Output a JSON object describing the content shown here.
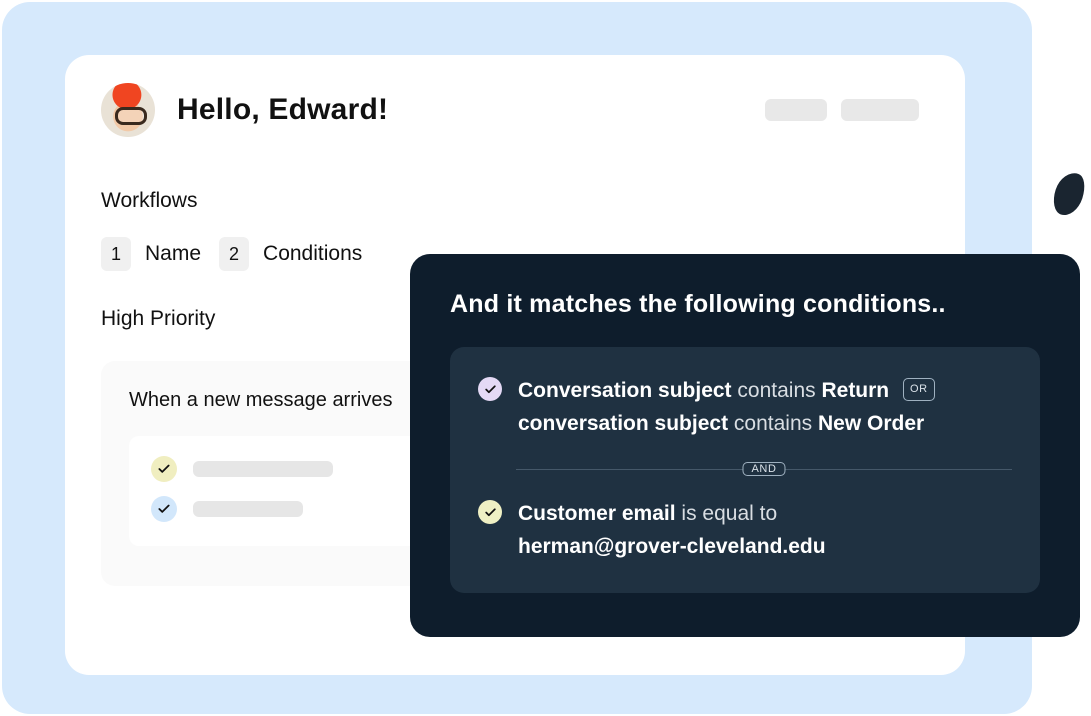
{
  "header": {
    "greeting": "Hello, Edward!"
  },
  "workflows": {
    "section_title": "Workflows",
    "steps": [
      {
        "num": "1",
        "label": "Name"
      },
      {
        "num": "2",
        "label": "Conditions"
      }
    ],
    "current_name": "High Priority",
    "trigger_card_title": "When a new message arrives"
  },
  "conditions_panel": {
    "title": "And it matches the following conditions..",
    "or_chip": "OR",
    "and_chip": "AND",
    "group1": {
      "line1_field": "Conversation subject",
      "line1_op": "contains",
      "line1_value": "Return",
      "line2_field": "conversation subject",
      "line2_op": "contains",
      "line2_value": "New Order"
    },
    "group2": {
      "field": "Customer email",
      "op": "is equal to",
      "value": "herman@grover-cleveland.edu"
    }
  }
}
